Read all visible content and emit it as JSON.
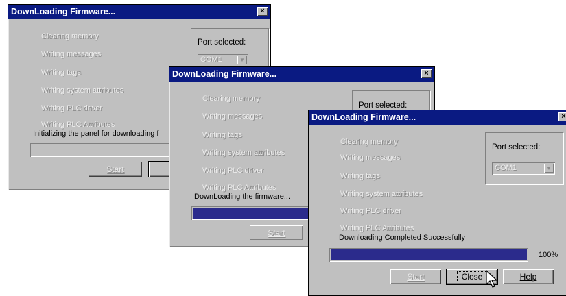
{
  "window_title": "DownLoading Firmware...",
  "close_symbol": "×",
  "steps": [
    "Clearing memory",
    "Writing messages",
    "Writing tags",
    "Writing system attributes",
    "Writing PLC driver",
    "Writing PLC Attributes"
  ],
  "port": {
    "label": "Port selected:",
    "value": "COM1"
  },
  "dialog1": {
    "status": "Initializing the panel for downloading f",
    "start": "Start",
    "close_partial": "C"
  },
  "dialog2": {
    "status": "DownLoading the firmware...",
    "progress": 1.0,
    "start": "Start"
  },
  "dialog3": {
    "status": "Downloading Completed Successfully",
    "progress": 1.0,
    "percent": "100%",
    "start": "Start",
    "close": "Close",
    "help": "Help"
  }
}
